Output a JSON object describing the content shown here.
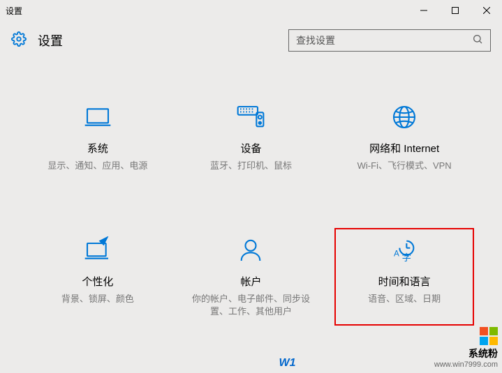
{
  "window": {
    "title": "设置"
  },
  "header": {
    "app_title": "设置",
    "search_placeholder": "查找设置"
  },
  "tiles": [
    {
      "title": "系统",
      "desc": "显示、通知、应用、电源"
    },
    {
      "title": "设备",
      "desc": "蓝牙、打印机、鼠标"
    },
    {
      "title": "网络和 Internet",
      "desc": "Wi-Fi、飞行模式、VPN"
    },
    {
      "title": "个性化",
      "desc": "背景、锁屏、颜色"
    },
    {
      "title": "帐户",
      "desc": "你的帐户、电子邮件、同步设置、工作、其他用户"
    },
    {
      "title": "时间和语言",
      "desc": "语音、区域、日期"
    }
  ],
  "watermark": {
    "text": "系统粉",
    "url": "www.win7999.com"
  },
  "page_indicator": "W1"
}
